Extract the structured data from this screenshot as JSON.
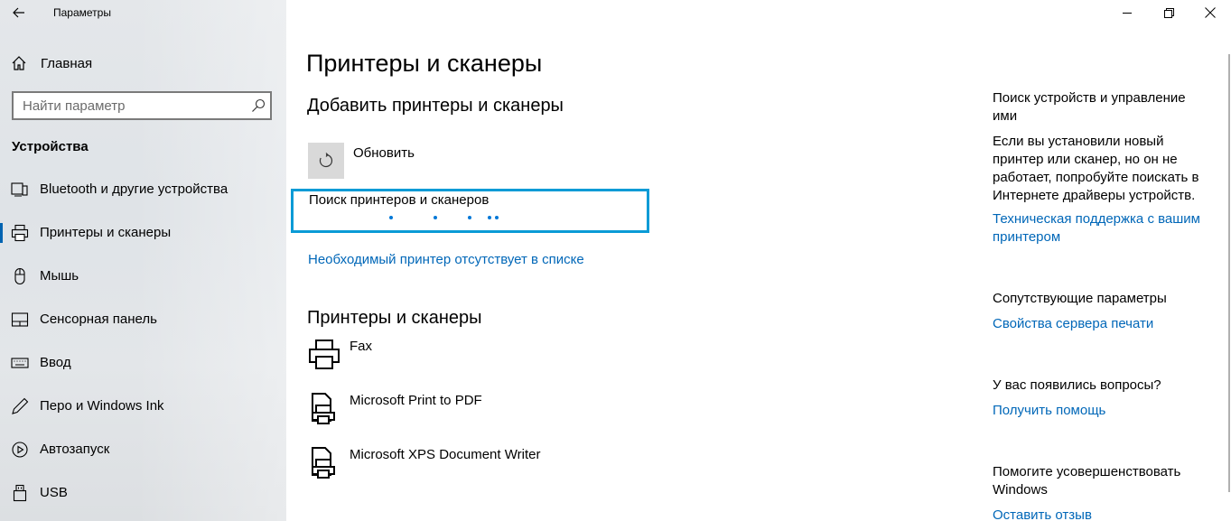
{
  "app": {
    "title": "Параметры"
  },
  "sidebar": {
    "home_label": "Главная",
    "search_placeholder": "Найти параметр",
    "section_title": "Устройства",
    "items": [
      {
        "label": "Bluetooth и другие устройства",
        "icon": "bluetooth-devices-icon"
      },
      {
        "label": "Принтеры и сканеры",
        "icon": "printer-icon",
        "active": true
      },
      {
        "label": "Мышь",
        "icon": "mouse-icon"
      },
      {
        "label": "Сенсорная панель",
        "icon": "touchpad-icon"
      },
      {
        "label": "Ввод",
        "icon": "keyboard-icon"
      },
      {
        "label": "Перо и Windows Ink",
        "icon": "pen-icon"
      },
      {
        "label": "Автозапуск",
        "icon": "autoplay-icon"
      },
      {
        "label": "USB",
        "icon": "usb-icon"
      }
    ]
  },
  "main": {
    "page_title": "Принтеры и сканеры",
    "add_section_title": "Добавить принтеры и сканеры",
    "refresh_label": "Обновить",
    "searching_label": "Поиск принтеров и сканеров",
    "missing_link": "Необходимый принтер отсутствует в списке",
    "printers_section_title": "Принтеры и сканеры",
    "printers": [
      {
        "name": "Fax",
        "icon": "fax-icon"
      },
      {
        "name": "Microsoft Print to PDF",
        "icon": "printer-document-icon"
      },
      {
        "name": "Microsoft XPS Document Writer",
        "icon": "printer-document-icon"
      }
    ]
  },
  "right_panel": {
    "discover_title": "Поиск устройств и управление ими",
    "discover_desc": "Если вы установили новый принтер или сканер, но он не работает, попробуйте поискать в Интернете драйверы устройств.",
    "support_link": "Техническая поддержка с вашим принтером",
    "related_title": "Сопутствующие параметры",
    "print_server_link": "Свойства сервера печати",
    "questions_title": "У вас появились вопросы?",
    "help_link": "Получить помощь",
    "improve_title": "Помогите усовершенствовать Windows",
    "feedback_link": "Оставить отзыв"
  },
  "colors": {
    "accent": "#0067b8",
    "search_border": "#0a9bd6",
    "sidebar_bg": "#e2e5e8"
  }
}
